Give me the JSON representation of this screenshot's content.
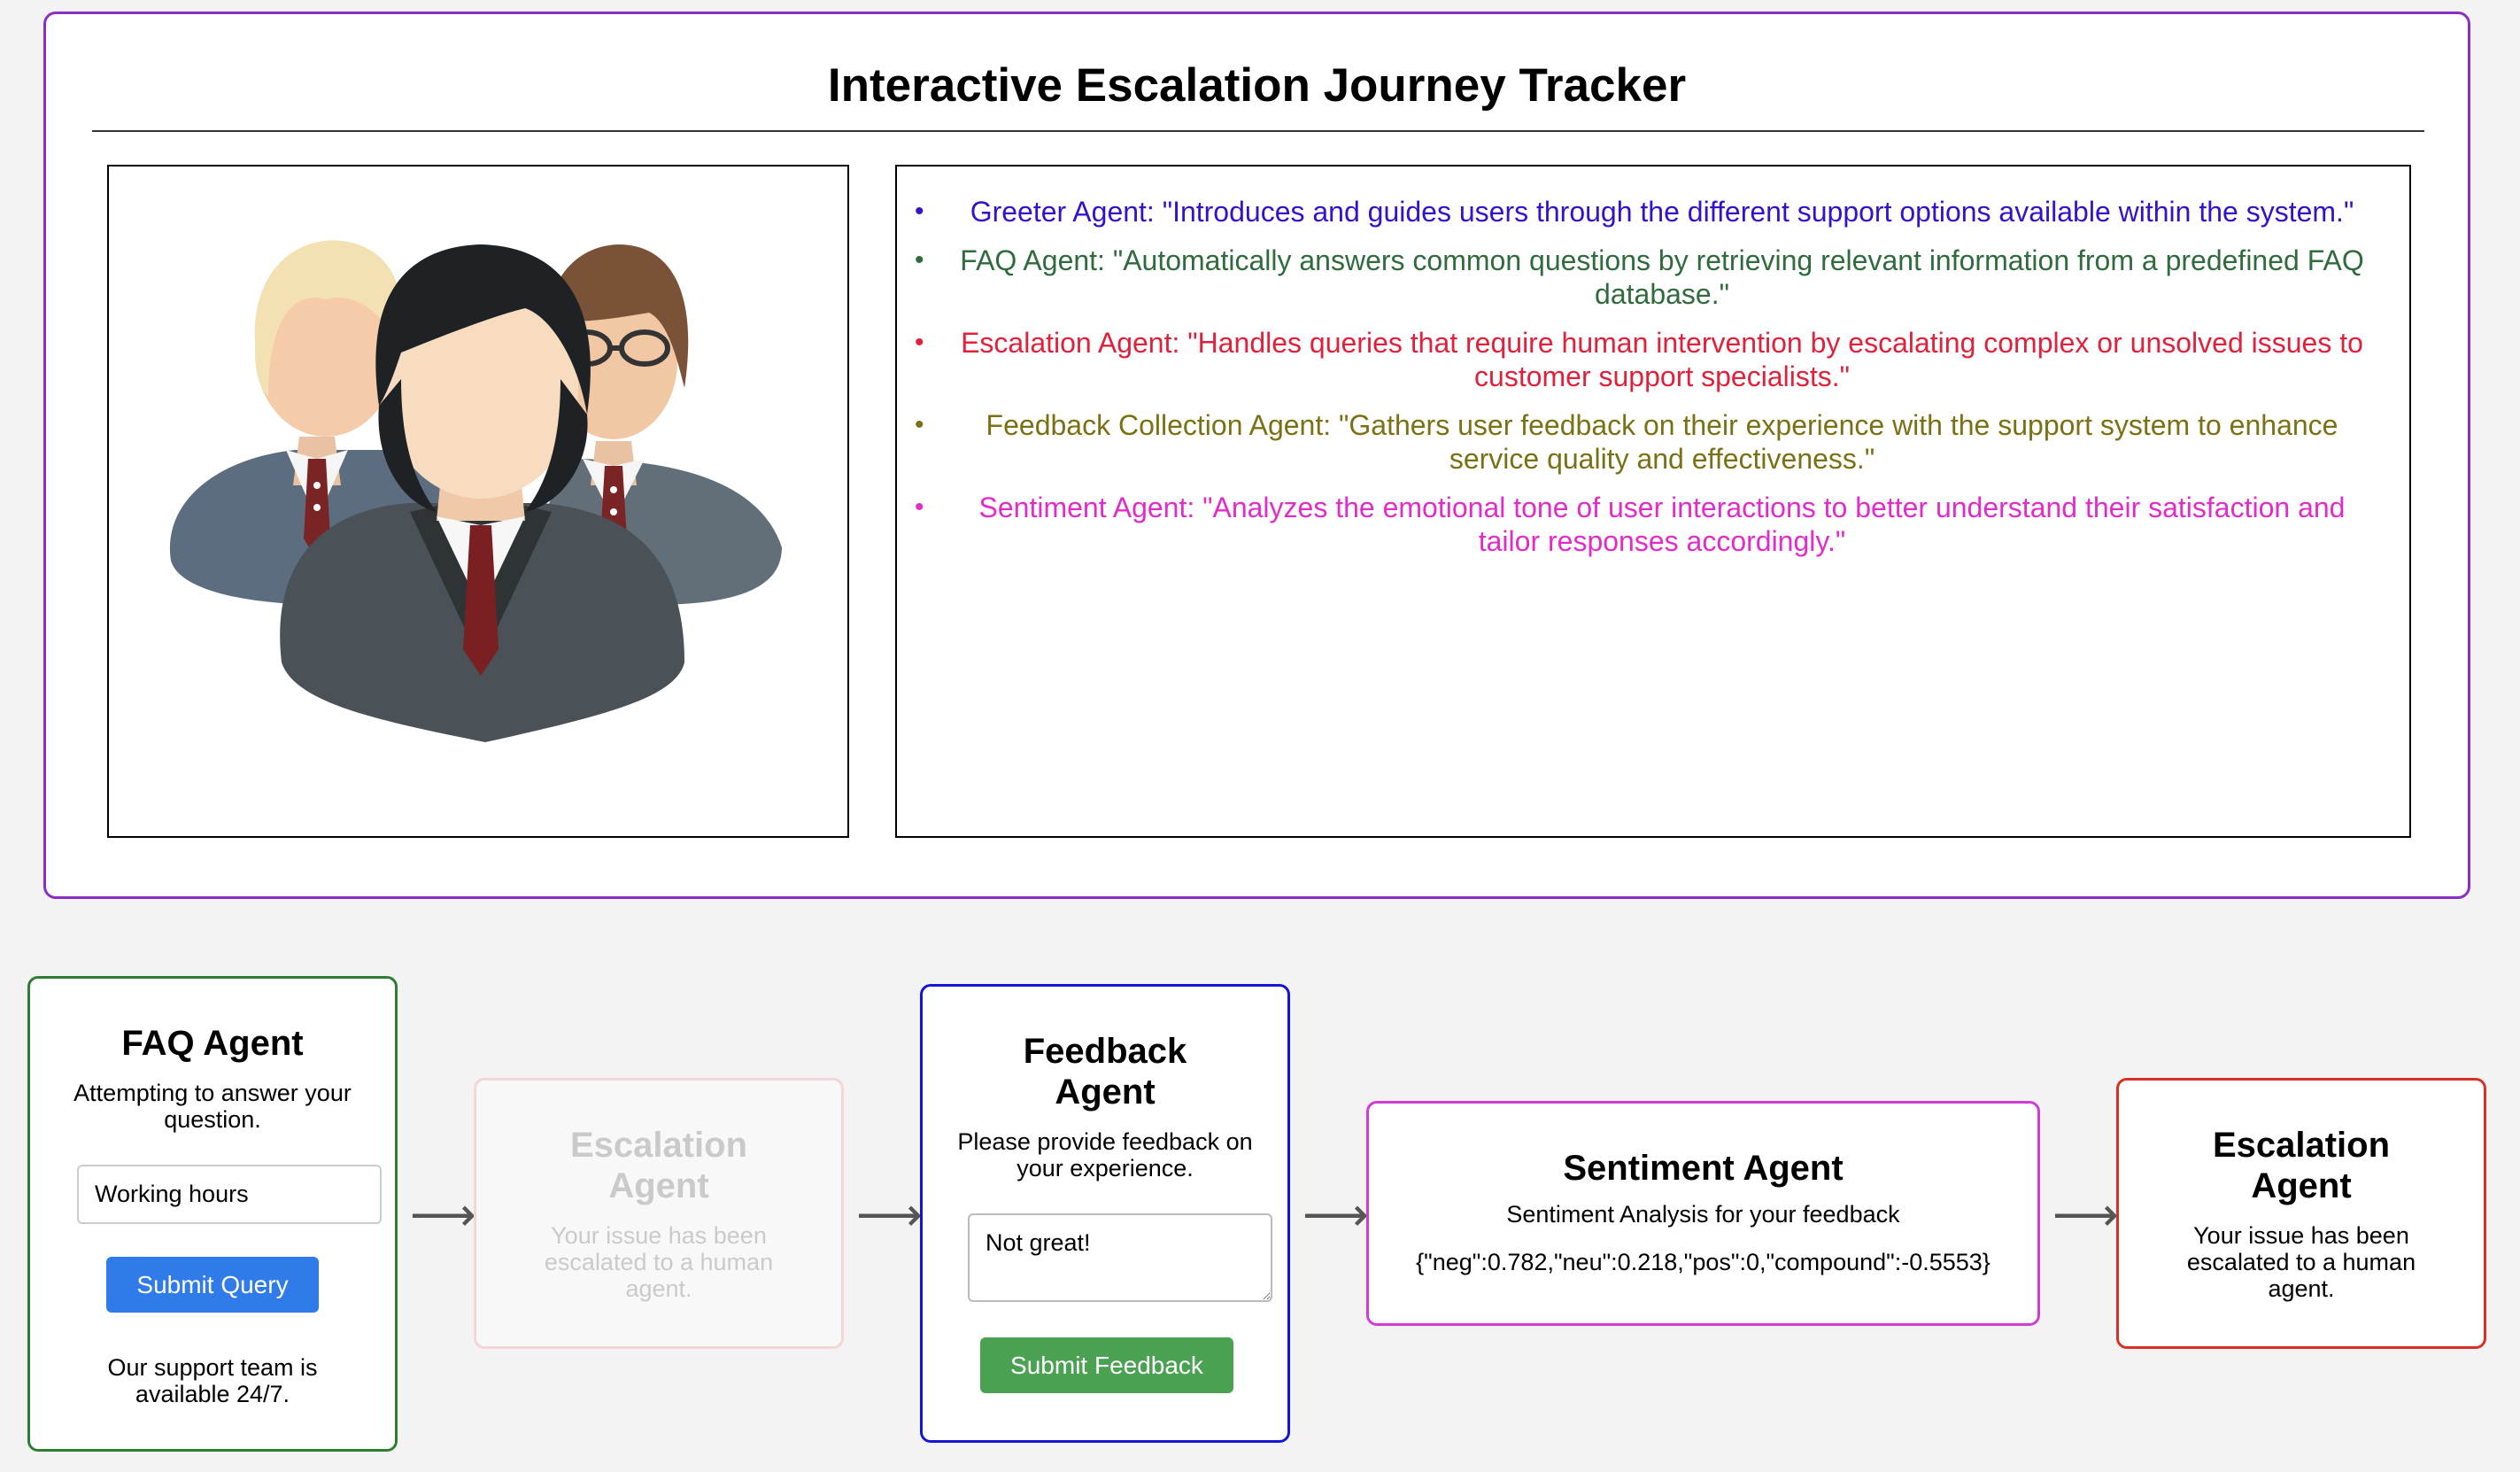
{
  "page": {
    "title": "Interactive Escalation Journey Tracker"
  },
  "agents_description": [
    {
      "text": "Greeter Agent: \"Introduces and guides users through the different support options available within the system.\"",
      "color": "#2f14c9"
    },
    {
      "text": "FAQ Agent: \"Automatically answers common questions by retrieving relevant information from a predefined FAQ database.\"",
      "color": "#2f6b3c"
    },
    {
      "text": "Escalation Agent: \"Handles queries that require human intervention by escalating complex or unsolved issues to customer support specialists.\"",
      "color": "#e0213c"
    },
    {
      "text": "Feedback Collection Agent: \"Gathers user feedback on their experience with the support system to enhance service quality and effectiveness.\"",
      "color": "#7a7014"
    },
    {
      "text": "Sentiment Agent: \"Analyzes the emotional tone of user interactions to better understand their satisfaction and tailor responses accordingly.\"",
      "color": "#e22cc9"
    }
  ],
  "bullet_glyph": "•",
  "image": {
    "icon": "support-team-illustration"
  },
  "flow": {
    "arrow_glyph": "⟶",
    "faq": {
      "title": "FAQ Agent",
      "status": "Attempting to answer your question.",
      "input_value": "Working hours",
      "button_label": "Submit Query",
      "answer": "Our support team is available 24/7.",
      "border_color": "#2e7d32",
      "button_color": "#2f7bea"
    },
    "escalation_pending": {
      "title": "Escalation Agent",
      "message": "Your issue has been escalated to a human agent.",
      "border_color": "#f3b3b3",
      "state": "inactive"
    },
    "feedback": {
      "title": "Feedback Agent",
      "prompt": "Please provide feedback on your experience.",
      "textarea_value": "Not great!",
      "button_label": "Submit Feedback",
      "border_color": "#1414d6",
      "button_color": "#4aa152"
    },
    "sentiment": {
      "title": "Sentiment Agent",
      "subtitle": "Sentiment Analysis for your feedback",
      "result": "{\"neg\":0.782,\"neu\":0.218,\"pos\":0,\"compound\":-0.5553}",
      "border_color": "#d23bd6"
    },
    "escalation_active": {
      "title": "Escalation Agent",
      "message": "Your issue has been escalated to a human agent.",
      "border_color": "#d93025",
      "state": "active"
    }
  }
}
